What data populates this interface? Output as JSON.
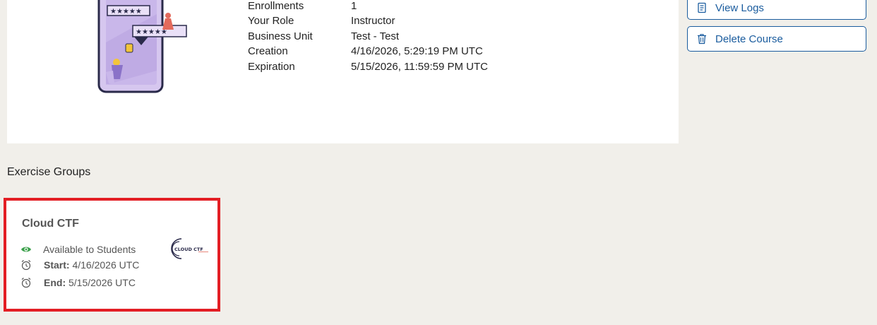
{
  "course_info": {
    "rows": [
      {
        "label": "Enrollments",
        "value": "1"
      },
      {
        "label": "Your Role",
        "value": "Instructor"
      },
      {
        "label": "Business Unit",
        "value": "Test - Test"
      },
      {
        "label": "Creation",
        "value": "4/16/2026, 5:29:19 PM UTC"
      },
      {
        "label": "Expiration",
        "value": "5/15/2026, 11:59:59 PM UTC"
      }
    ]
  },
  "actions": {
    "view_logs_label": "View Logs",
    "delete_course_label": "Delete Course",
    "view_logs_icon": "logs-icon",
    "delete_course_icon": "trash-icon",
    "accent_color": "#1a5c9e"
  },
  "exercise_groups": {
    "title": "Exercise Groups",
    "cards": [
      {
        "title": "Cloud CTF",
        "availability": "Available to Students",
        "start_label": "Start:",
        "start_value": "4/16/2026 UTC",
        "end_label": "End:",
        "end_value": "5/15/2026 UTC",
        "logo_text": "CLOUD CTF",
        "highlight_color": "#e31e24",
        "availability_icon_color": "#3aa04a"
      }
    ]
  }
}
